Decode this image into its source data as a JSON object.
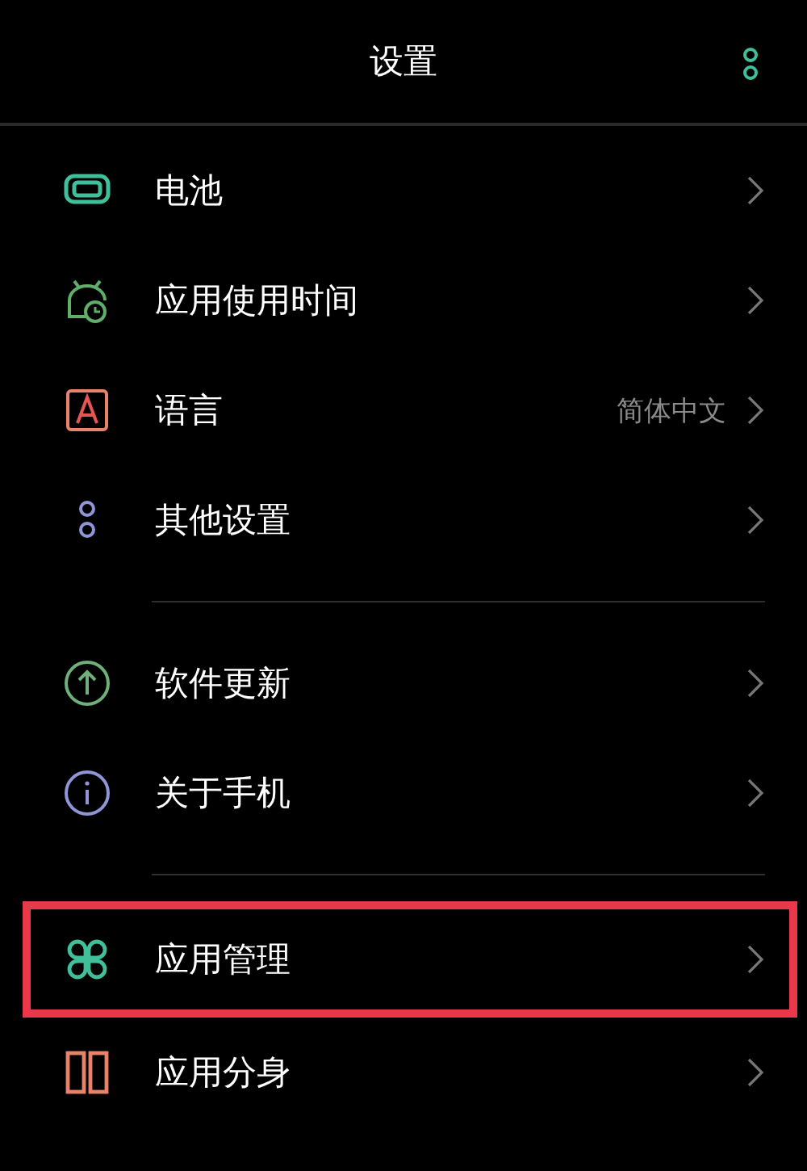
{
  "header": {
    "title": "设置"
  },
  "groups": [
    {
      "items": [
        {
          "label": "电池",
          "color": "#3fbf9a",
          "highlighted": false
        },
        {
          "label": "应用使用时间",
          "color": "#5fae6a",
          "highlighted": false
        },
        {
          "label": "语言",
          "value": "简体中文",
          "color": "#e8836a",
          "highlighted": false
        },
        {
          "label": "其他设置",
          "color": "#8f95d6",
          "highlighted": false
        }
      ]
    },
    {
      "items": [
        {
          "label": "软件更新",
          "color": "#6fb07a",
          "highlighted": false
        },
        {
          "label": "关于手机",
          "color": "#8f95d6",
          "highlighted": false
        }
      ]
    },
    {
      "items": [
        {
          "label": "应用管理",
          "color": "#3fbf9a",
          "highlighted": true
        },
        {
          "label": "应用分身",
          "color": "#e8836a",
          "highlighted": false
        }
      ]
    }
  ]
}
